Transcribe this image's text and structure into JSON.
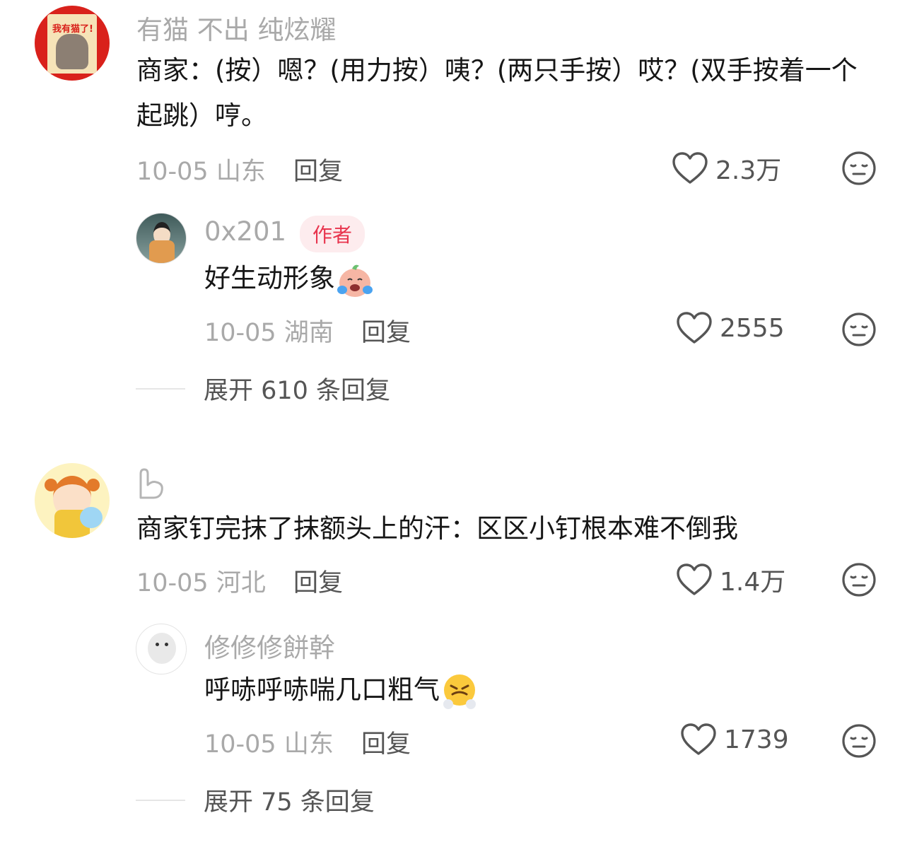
{
  "comments": [
    {
      "username": "有猫 不出 纯炫耀",
      "avatar_text": "我有猫了!",
      "text": "商家：(按）嗯？(用力按）咦？(两只手按）哎？(双手按着一个起跳）哼。",
      "date": "10-05",
      "location": "山东",
      "reply_label": "回复",
      "likes": "2.3万",
      "replies": [
        {
          "username": "0x201",
          "badge": "作者",
          "text": "好生动形象",
          "emoji": "crying-laughing-emoji",
          "date": "10-05",
          "location": "湖南",
          "reply_label": "回复",
          "likes": "2555"
        }
      ],
      "expand_label": "展开 610 条回复"
    },
    {
      "username_icon": "hand-icon",
      "text": "商家钉完抹了抹额头上的汗：区区小钉根本难不倒我",
      "date": "10-05",
      "location": "河北",
      "reply_label": "回复",
      "likes": "1.4万",
      "replies": [
        {
          "username": "修修修餅幹",
          "text": "呼哧呼哧喘几口粗气",
          "emoji": "huffing-emoji",
          "date": "10-05",
          "location": "山东",
          "reply_label": "回复",
          "likes": "1739"
        }
      ],
      "expand_label": "展开 75 条回复"
    }
  ],
  "colors": {
    "meta_gray": "#a9a9a9",
    "author_badge_bg": "#fdecee",
    "author_badge_text": "#e8344d"
  }
}
